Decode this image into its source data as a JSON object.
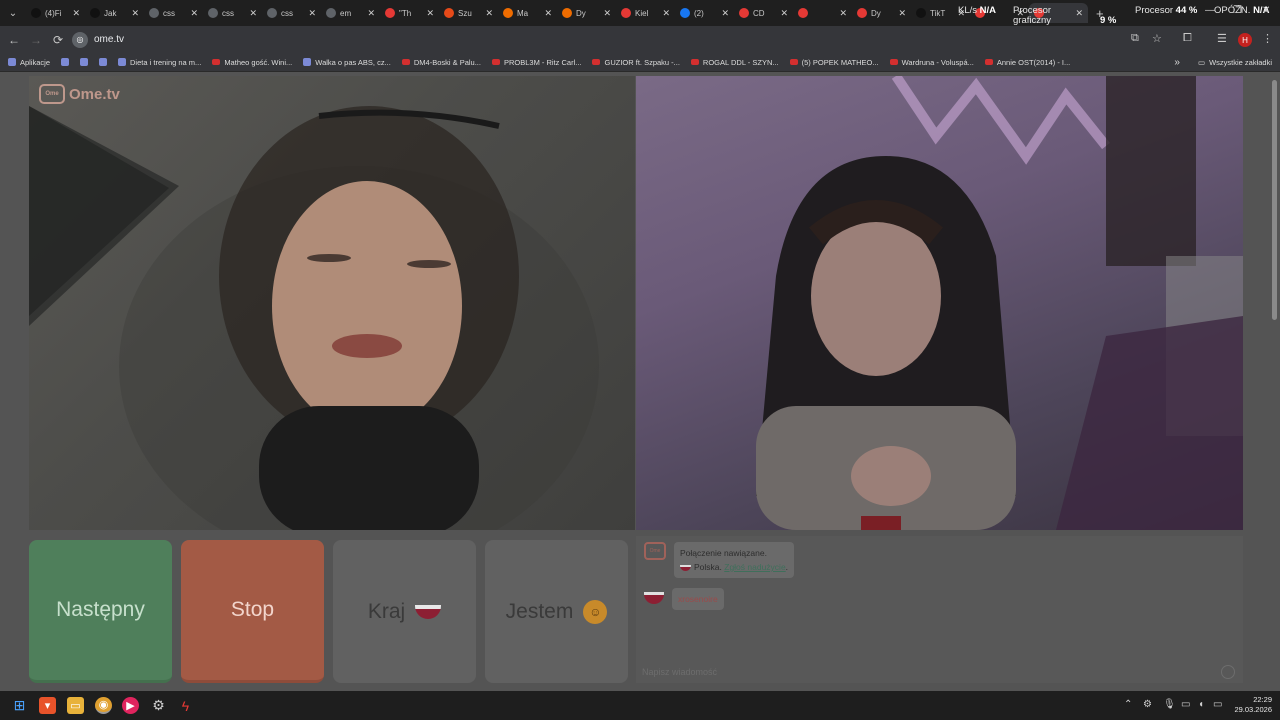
{
  "browser": {
    "tabs": [
      {
        "title": "(4)Fi",
        "favicon": "tiktok-icon",
        "color": "#111111"
      },
      {
        "title": "Jak",
        "favicon": "tiktok-icon",
        "color": "#111111"
      },
      {
        "title": "css",
        "favicon": "chrome-page-icon",
        "color": "#5f6368"
      },
      {
        "title": "css",
        "favicon": "chrome-page-icon",
        "color": "#5f6368"
      },
      {
        "title": "css",
        "favicon": "chrome-page-icon",
        "color": "#5f6368"
      },
      {
        "title": "em",
        "favicon": "chrome-page-icon",
        "color": "#5f6368"
      },
      {
        "title": "\"Th",
        "favicon": "youtube-icon",
        "color": "#e53935"
      },
      {
        "title": "Szu",
        "favicon": "flame-icon",
        "color": "#e64a19"
      },
      {
        "title": "Ma",
        "favicon": "a-icon",
        "color": "#ef6c00"
      },
      {
        "title": "Dy",
        "favicon": "a-icon",
        "color": "#ef6c00"
      },
      {
        "title": "Kiel",
        "favicon": "youtube-icon",
        "color": "#e53935"
      },
      {
        "title": "(2)",
        "favicon": "facebook-icon",
        "color": "#1877f2"
      },
      {
        "title": "CD",
        "favicon": "youtube-icon",
        "color": "#e53935"
      },
      {
        "title": "",
        "favicon": "youtube-icon",
        "color": "#e53935"
      },
      {
        "title": "Dy",
        "favicon": "youtube-icon",
        "color": "#e53935"
      },
      {
        "title": "TikT",
        "favicon": "tiktok-icon",
        "color": "#111111"
      },
      {
        "title": "",
        "favicon": "youtube-icon",
        "color": "#e53935"
      },
      {
        "title": "",
        "favicon": "mail-icon",
        "color": "#e53935",
        "active": true
      }
    ],
    "new_tab_label": "+",
    "osd": {
      "kls_label": "KL/s",
      "kls_value": "N/A",
      "gpu_label_1": "Procesor",
      "gpu_label_2": "graficzny",
      "gpu_value": "9 %",
      "cpu_label": "Procesor",
      "cpu_value": "44 %",
      "lag_label": "OPÓŹN.",
      "lag_value": "N/A"
    },
    "url": "ome.tv",
    "bookmarks": [
      {
        "label": "Aplikacje",
        "icon": "apps-grid-icon"
      },
      {
        "label": "",
        "icon": "grid-icon"
      },
      {
        "label": "",
        "icon": "ext-icon"
      },
      {
        "label": "",
        "icon": "gmail-icon"
      },
      {
        "label": "Dieta i trening na m...",
        "icon": "mi-icon"
      },
      {
        "label": "Matheo gość. Wini...",
        "icon": "youtube-icon"
      },
      {
        "label": "Walka o pas ABS, cz...",
        "icon": "tiktok-icon"
      },
      {
        "label": "DM4-Boski & Palu...",
        "icon": "youtube-icon"
      },
      {
        "label": "PROBL3M - Ritz Carl...",
        "icon": "youtube-icon"
      },
      {
        "label": "GUZIOR ft. Szpaku -...",
        "icon": "youtube-icon"
      },
      {
        "label": "ROGAL DDL - SZYN...",
        "icon": "youtube-icon"
      },
      {
        "label": "(5) POPEK MATHEO...",
        "icon": "youtube-icon"
      },
      {
        "label": "Wardruna - Voluspá...",
        "icon": "youtube-icon"
      },
      {
        "label": "Annie OST(2014) - I...",
        "icon": "youtube-icon"
      }
    ],
    "bookmarks_more": "»",
    "all_bookmarks": "Wszystkie zakładki"
  },
  "omegle": {
    "logo_text": "Ome.tv",
    "buttons": {
      "next": "Następny",
      "stop": "Stop",
      "country": "Kraj",
      "me": "Jestem"
    },
    "chat": {
      "connected": "Połączenie nawiązane.",
      "country": "Polska.",
      "report_link": "Zgłoś nadużycie",
      "report_suffix": ".",
      "partner_name": "xrosenoire",
      "input_placeholder": "Napisz wiadomość"
    }
  },
  "taskbar": {
    "time": "22:29",
    "date": "29.03.2026"
  },
  "colors": {
    "next_button": "#4f7f5b",
    "stop_button": "#a35a45",
    "overlay_dim": "#545454"
  }
}
